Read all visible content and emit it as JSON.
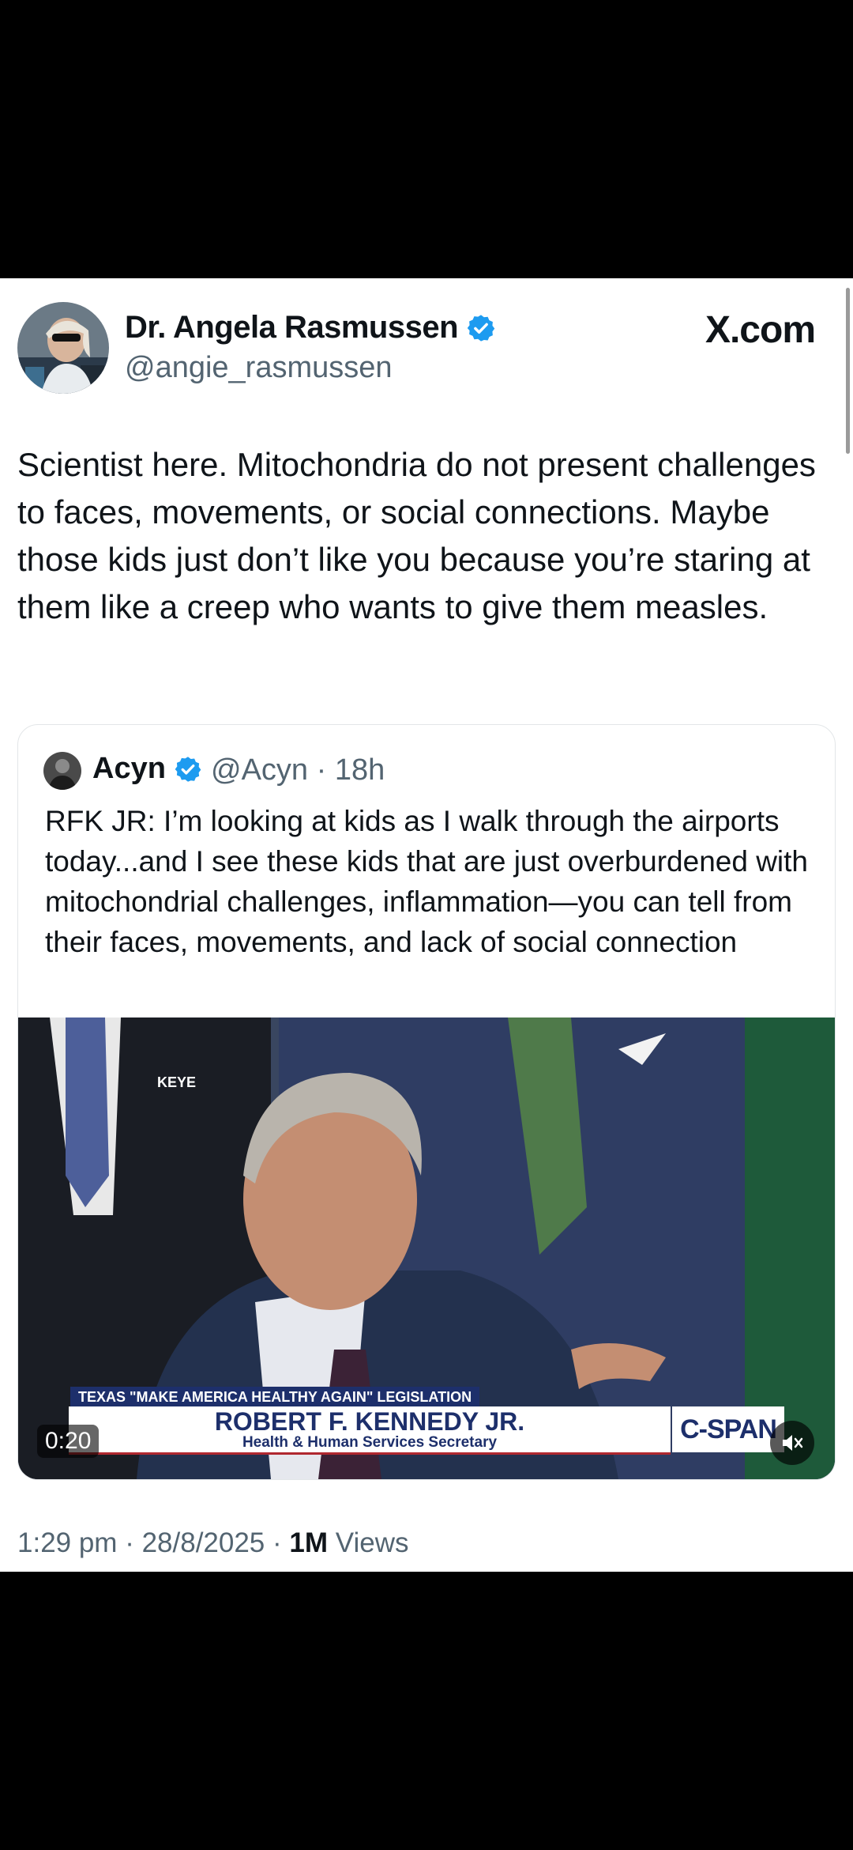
{
  "site": {
    "brand": "X.com"
  },
  "author": {
    "name": "Dr. Angela Rasmussen",
    "handle": "@angie_rasmussen",
    "verified": true
  },
  "tweet": {
    "text": "Scientist here. Mitochondria do not present challenges to faces, movements, or social connections. Maybe those kids just don’t like you because you’re staring at them like a creep who wants to give them measles."
  },
  "quoted": {
    "name": "Acyn",
    "handle": "@Acyn · 18h",
    "text": "RFK JR: I’m looking at kids as I walk through the airports today...and I see these kids that are just overburdened with mitochondrial challenges, inflammation—you can tell from their faces, movements, and lack of social connection",
    "video": {
      "station_tag": "KEYE",
      "chyron_topic": "TEXAS \"MAKE AMERICA HEALTHY AGAIN\" LEGISLATION",
      "chyron_name": "ROBERT F. KENNEDY JR.",
      "chyron_title": "Health & Human Services Secretary",
      "network": "C-SPAN",
      "duration": "0:20"
    }
  },
  "meta": {
    "time_date": "1:29 pm · 28/8/2025 · ",
    "views_count": "1M",
    "views_label": " Views"
  },
  "colors": {
    "verified": "#1d9bf0",
    "muted_text": "#536471",
    "chyron_blue": "#1d2f6b"
  }
}
